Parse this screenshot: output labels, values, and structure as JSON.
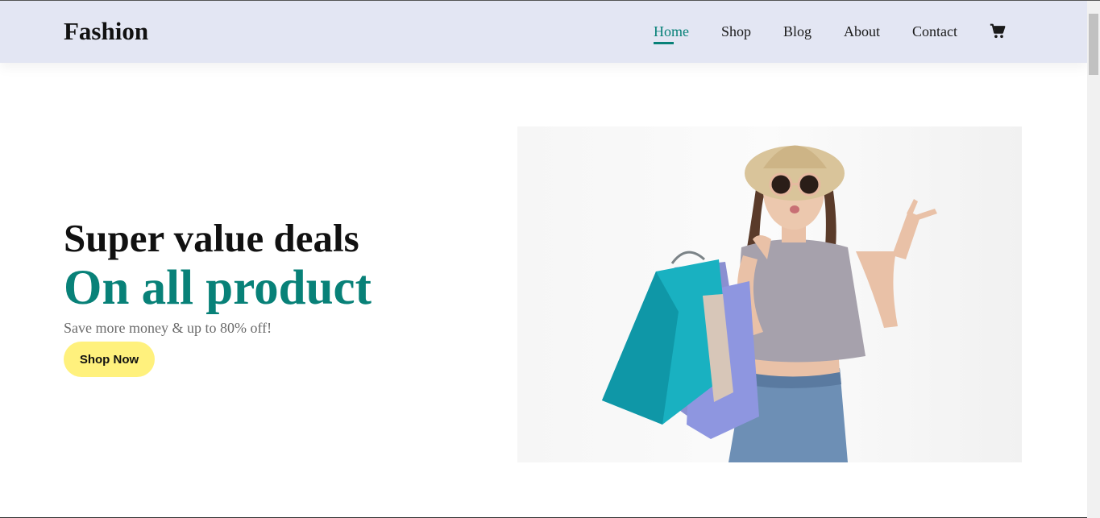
{
  "header": {
    "logo": "Fashion",
    "nav": [
      {
        "label": "Home",
        "active": true
      },
      {
        "label": "Shop",
        "active": false
      },
      {
        "label": "Blog",
        "active": false
      },
      {
        "label": "About",
        "active": false
      },
      {
        "label": "Contact",
        "active": false
      }
    ],
    "cart_icon": "shopping-cart-icon"
  },
  "hero": {
    "title": "Super value deals",
    "highlight": "On all product",
    "subtitle": "Save more money & up to 80% off!",
    "button_label": "Shop Now",
    "image_subject": "woman with sunglasses and hat holding shopping bags"
  },
  "colors": {
    "accent": "#088178",
    "navbar_bg": "#e3e6f3",
    "button_bg": "#fff17d"
  }
}
